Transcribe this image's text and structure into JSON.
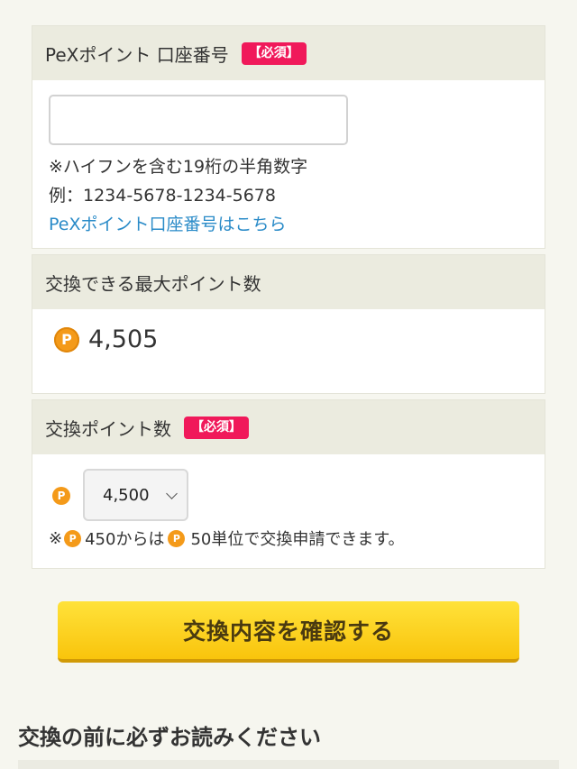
{
  "account_section": {
    "title": "PeXポイント 口座番号",
    "required_badge": "【必須】",
    "input_value": "",
    "note_line1": "※ハイフンを含む19桁の半角数字",
    "note_line2": "例：1234-5678-1234-5678",
    "link_text": "PeXポイント口座番号はこちら"
  },
  "max_points_section": {
    "title": "交換できる最大ポイント数",
    "value": "4,505"
  },
  "exchange_section": {
    "title": "交換ポイント数",
    "required_badge": "【必須】",
    "selected_value": "4,500",
    "note_prefix": "※",
    "note_part1": "450からは",
    "note_part2": "50単位で交換申請できます。"
  },
  "confirm_button_label": "交換内容を確認する",
  "notice_heading": "交換の前に必ずお読みください",
  "coin_symbol": "P",
  "colors": {
    "accent_badge": "#f0195a",
    "link": "#2a8bc8",
    "coin": "#f49a19",
    "button": "#f9c40c"
  },
  "icons": [
    "point-coin-icon",
    "chevron-down-icon"
  ]
}
